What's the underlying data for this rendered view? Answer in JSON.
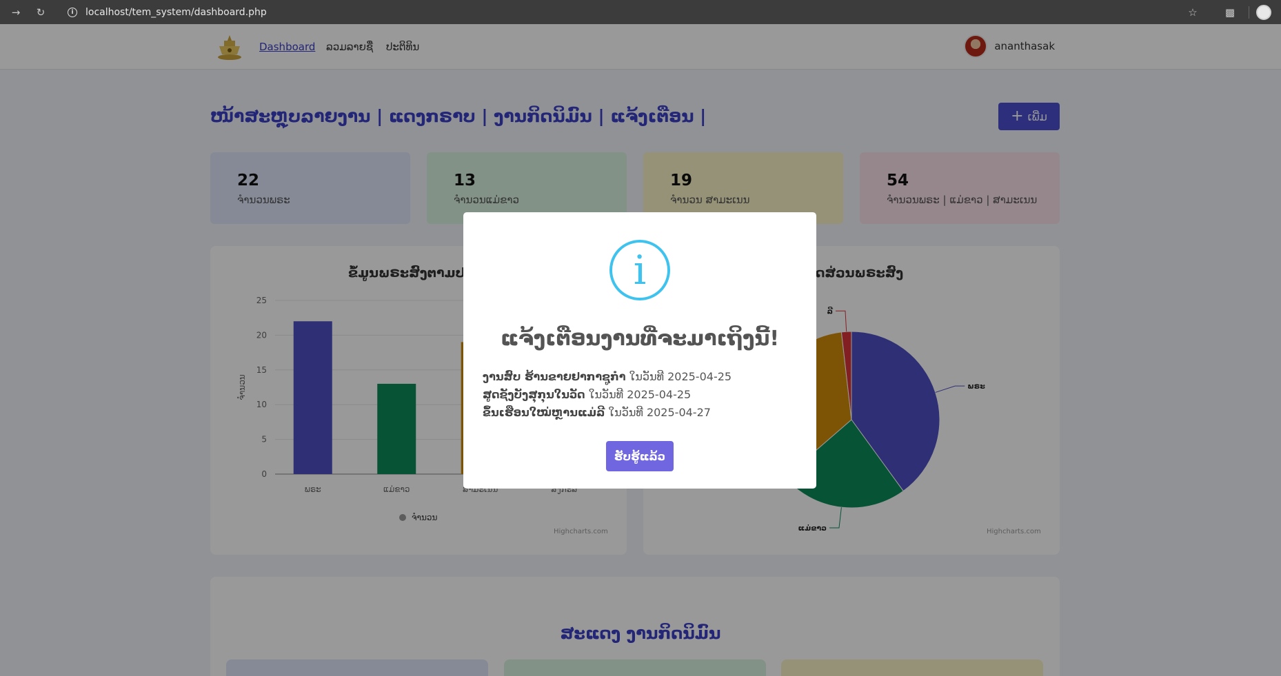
{
  "browser": {
    "url": "localhost/tem_system/dashboard.php",
    "icons": [
      "forward-icon",
      "reload-icon",
      "site-info-icon",
      "bookmark-star-icon",
      "extensions-icon"
    ]
  },
  "nav": {
    "links": [
      "Dashboard",
      "ລວມລາຍຊື່",
      "ປະຕິທິນ"
    ],
    "username": "ananthasak"
  },
  "header": {
    "title": "ໜ້າສະຫຼຸບລາຍງານ | ແດງກຣາບ | ງານກິດນິມົນ | ແຈ້ງເຕືອນ |",
    "add_label": "ເພີ່ມ"
  },
  "stats": [
    {
      "value": "22",
      "label": "ຈຳນວນພຣະ",
      "color": "#dfe6fa"
    },
    {
      "value": "13",
      "label": "ຈຳນວນແມ່ຂາວ",
      "color": "#daf3e1"
    },
    {
      "value": "19",
      "label": "ຈຳນວນ ສາມະເນນ",
      "color": "#fbf4c8"
    },
    {
      "value": "54",
      "label": "ຈຳນວນພຣະ | ແມ່ຂາວ | ສາມະເນນ",
      "color": "#fbe1ea"
    }
  ],
  "charts": {
    "bar_title": "ຂໍ້ມູນພຣະສົງຕາມປະ",
    "pie_title": "ດສ່ວນພຣະສົງ",
    "credit": "Highcharts.com"
  },
  "chart_data": [
    {
      "type": "bar",
      "categories": [
        "ພຣະ",
        "ແມ່ຂາວ",
        "ສາມະເນນ",
        "ສົງກະລີ"
      ],
      "series": [
        {
          "name": "ຈຳນວນ",
          "values": [
            22,
            13,
            19,
            0
          ]
        }
      ],
      "ylabel": "ຈຳນວນ",
      "ylim": [
        0,
        25
      ],
      "yticks": [
        0,
        5,
        10,
        15,
        20,
        25
      ],
      "colors": [
        "#4d4fc2",
        "#0d8a5a",
        "#d08d0a",
        "#c0392b"
      ]
    },
    {
      "type": "pie",
      "labels": [
        "ພຣະ",
        "ແມ່ຂາວ",
        "ສາມະເນນ",
        "ສົງກະລີ"
      ],
      "values": [
        22,
        13,
        19,
        1
      ],
      "visible_labels": [
        "ພຣະ",
        "ແມ່ຂາວ",
        "ລີ"
      ],
      "colors": [
        "#4d4fc2",
        "#0d8a5a",
        "#d08d0a",
        "#d9343b"
      ]
    }
  ],
  "section": {
    "title": "ສະແດງ ງານກິດນິມົນ"
  },
  "mini_cards": [
    "#dfe6fa",
    "#daf3e1",
    "#fbf4c8"
  ],
  "modal": {
    "icon": "info-icon",
    "title": "ແຈ້ງເຕືອນງານທີ່ຈະມາເຖິງນີ້!",
    "events": [
      {
        "name": "ງານສົບ ຮ້ານຂາຍຢາກາຊູກຳ",
        "date": "ໃນວັນທີ 2025-04-25"
      },
      {
        "name": "ສູດຊັງບັງສຸກຸນໃນວັດ",
        "date": "ໃນວັນທີ 2025-04-25"
      },
      {
        "name": "ຂຶ້ນເຮືອນໃໝ່ຫຼານແມ່ລີ",
        "date": "ໃນວັນທີ 2025-04-27"
      }
    ],
    "ok_label": "ຮັບຮູ້ແລ້ວ"
  }
}
